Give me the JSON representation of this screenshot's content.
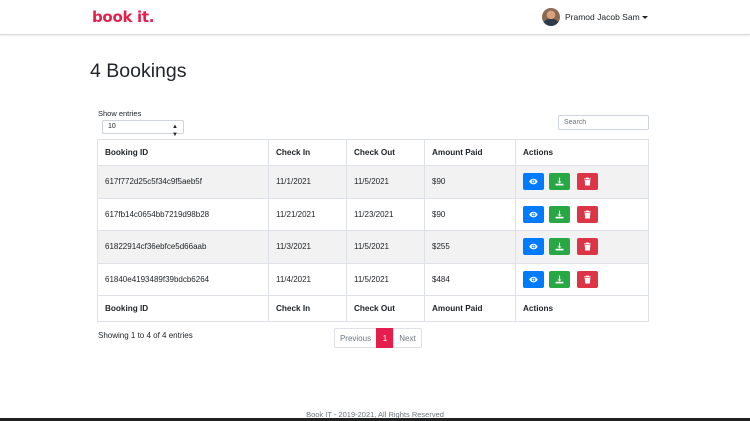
{
  "header": {
    "brand": "book it.",
    "user_name": "Pramod Jacob Sam",
    "brand_color": "#e61e4d"
  },
  "main": {
    "title": "4 Bookings",
    "show_entries_label": "Show entries",
    "entries_value": "10",
    "search_placeholder": "Search",
    "columns": [
      "Booking ID",
      "Check In",
      "Check Out",
      "Amount Paid",
      "Actions"
    ],
    "rows": [
      {
        "id": "617f772d25c5f34c9f5aeb5f",
        "check_in": "11/1/2021",
        "check_out": "11/5/2021",
        "amount": "$90"
      },
      {
        "id": "617fb14c0654bb7219d98b28",
        "check_in": "11/21/2021",
        "check_out": "11/23/2021",
        "amount": "$90"
      },
      {
        "id": "61822914cf36ebfce5d66aab",
        "check_in": "11/3/2021",
        "check_out": "11/5/2021",
        "amount": "$255"
      },
      {
        "id": "61840e4193489f39bdcb6264",
        "check_in": "11/4/2021",
        "check_out": "11/5/2021",
        "amount": "$484"
      }
    ],
    "actions": [
      {
        "icon": "eye-icon",
        "color": "#007bff"
      },
      {
        "icon": "download-icon",
        "color": "#28a745"
      },
      {
        "icon": "trash-icon",
        "color": "#dc3545"
      }
    ],
    "info_text": "Showing 1 to 4 of 4 entries",
    "pagination": {
      "previous": "Previous",
      "current_page": "1",
      "next": "Next"
    }
  },
  "footer": {
    "text": "Book IT - 2019-2021, All Rights Reserved"
  }
}
